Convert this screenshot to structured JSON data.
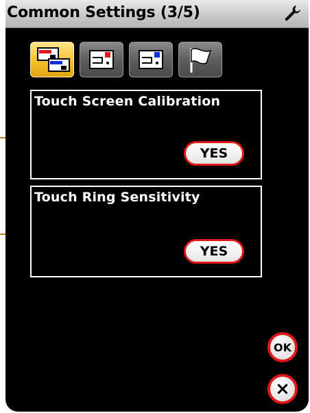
{
  "title": "Common Settings (3/5)",
  "icons": {
    "header": "wrench-icon",
    "tabs": [
      "machine-settings-icon",
      "sewing-settings-icon",
      "embroidery-settings-icon",
      "flag-icon"
    ]
  },
  "panels": [
    {
      "label": "Touch Screen Calibration",
      "button": "YES"
    },
    {
      "label": "Touch Ring Sensitivity",
      "button": "YES"
    }
  ],
  "buttons": {
    "ok": "OK",
    "close": "×"
  },
  "colors": {
    "accent_red": "#e01818",
    "active_tab": "#f6c12f",
    "background": "#000000",
    "leader_line": "#bf7a22"
  }
}
